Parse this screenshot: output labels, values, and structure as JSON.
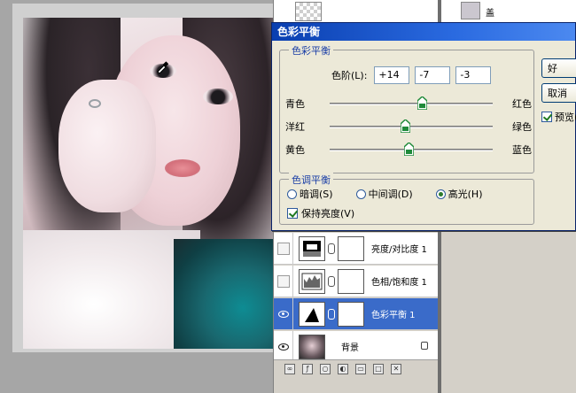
{
  "dialog": {
    "title": "色彩平衡",
    "balance_group": {
      "legend": "色彩平衡",
      "levels_label": "色阶(L):",
      "levels": [
        "+14",
        "-7",
        "-3"
      ],
      "sliders": [
        {
          "left": "青色",
          "right": "红色",
          "value": 14
        },
        {
          "left": "洋红",
          "right": "绿色",
          "value": -7
        },
        {
          "left": "黄色",
          "right": "蓝色",
          "value": -3
        }
      ]
    },
    "tone_group": {
      "legend": "色调平衡",
      "shadows": "暗调(S)",
      "midtones": "中间调(D)",
      "highlights": "高光(H)",
      "selected": "highlights",
      "preserve_luminosity": "保持亮度(V)",
      "preserve_checked": true
    },
    "buttons": {
      "ok": "好",
      "cancel": "取消"
    },
    "preview_label": "预览(",
    "preview_checked": true
  },
  "layers": [
    {
      "name": "亮度/对比度 1",
      "visible": false,
      "selected": false
    },
    {
      "name": "色相/饱和度 1",
      "visible": false,
      "selected": false
    },
    {
      "name": "色彩平衡 1",
      "visible": true,
      "selected": true
    },
    {
      "name": "背景",
      "visible": true,
      "selected": false,
      "locked": true
    }
  ],
  "right_panel": {
    "layer_label": "盖"
  },
  "colors": {
    "selection": "#3a6bc9",
    "titlebar": "#0a3fb0",
    "legend_text": "#1a3ea6",
    "slider_thumb": "#1f8a3a"
  }
}
